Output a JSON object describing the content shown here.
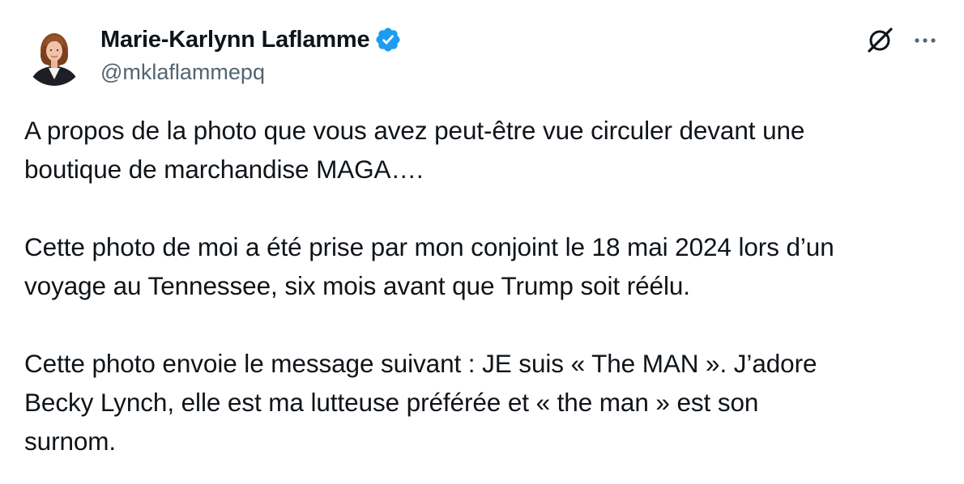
{
  "author": {
    "display_name": "Marie-Karlynn Laflamme",
    "handle": "@mklaflammepq",
    "verified": true,
    "avatar_icon": "profile-photo"
  },
  "actions": {
    "grok_icon": "grok-icon",
    "more_icon": "more-options-icon"
  },
  "tweet": {
    "paragraphs": [
      "A propos de la photo que vous avez peut-être vue circuler devant une\nboutique de marchandise MAGA….",
      "Cette photo de moi a été prise par mon conjoint le 18 mai 2024 lors d’un\nvoyage au Tennessee, six mois avant que Trump soit réélu.",
      "Cette photo envoie le message suivant : JE suis « The MAN ». J’adore\nBecky Lynch, elle est ma lutteuse préférée et « the man » est son\nsurnom."
    ]
  },
  "colors": {
    "text_primary": "#0f1419",
    "text_secondary": "#536471",
    "verified_blue": "#1d9bf0"
  }
}
